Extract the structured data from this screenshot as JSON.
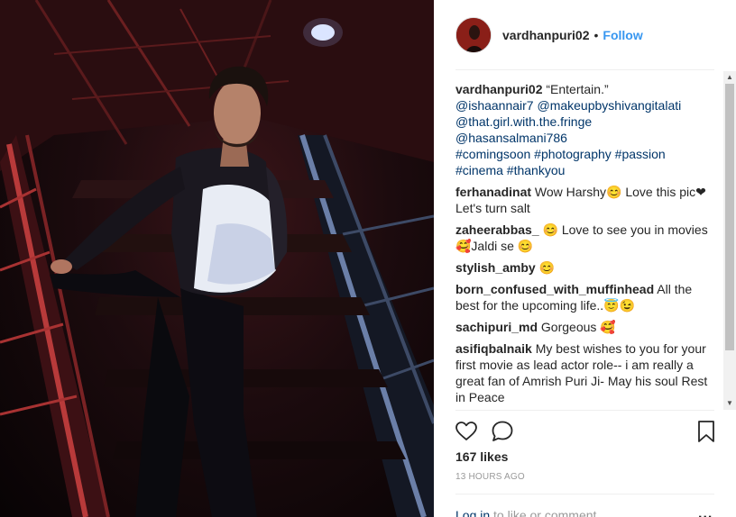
{
  "post": {
    "username": "vardhanpuri02",
    "separator": "•",
    "follow_label": "Follow"
  },
  "caption": {
    "username": "vardhanpuri02",
    "text": "“Entertain.”",
    "tags_line1": "@ishaannair7 @makeupbyshivangitalati",
    "tags_line2": "@that.girl.with.the.fringe",
    "tags_line3": "@hasansalmani786",
    "tags_line4": "#comingsoon #photography #passion",
    "tags_line5": "#cinema #thankyou"
  },
  "comments": [
    {
      "username": "ferhanadinat",
      "text": "Wow Harshy😊 Love this pic❤ Let's turn salt"
    },
    {
      "username": "zaheerabbas_",
      "text": "😊 Love to see you in movies 🥰Jaldi se 😊"
    },
    {
      "username": "stylish_amby",
      "text": "😊"
    },
    {
      "username": "born_confused_with_muffinhead",
      "text": "All the best for the upcoming life..😇😉"
    },
    {
      "username": "sachipuri_md",
      "text": "Gorgeous 🥰"
    },
    {
      "username": "asifiqbalnaik",
      "text": "My best wishes to you for your first movie as lead actor role-- i am really a great fan of Amrish Puri Ji- May his soul Rest in Peace"
    }
  ],
  "likes": "167 likes",
  "timestamp": "13 HOURS AGO",
  "login": {
    "link": "Log in",
    "rest": " to like or comment."
  },
  "more": "...",
  "scroll": {
    "up": "▲",
    "down": "▼"
  },
  "icons": {
    "like": "heart-icon",
    "comment": "comment-icon",
    "save": "bookmark-icon"
  },
  "colors": {
    "link_blue": "#3897f0",
    "tag_blue": "#003569",
    "text": "#262626",
    "muted": "#999999"
  }
}
